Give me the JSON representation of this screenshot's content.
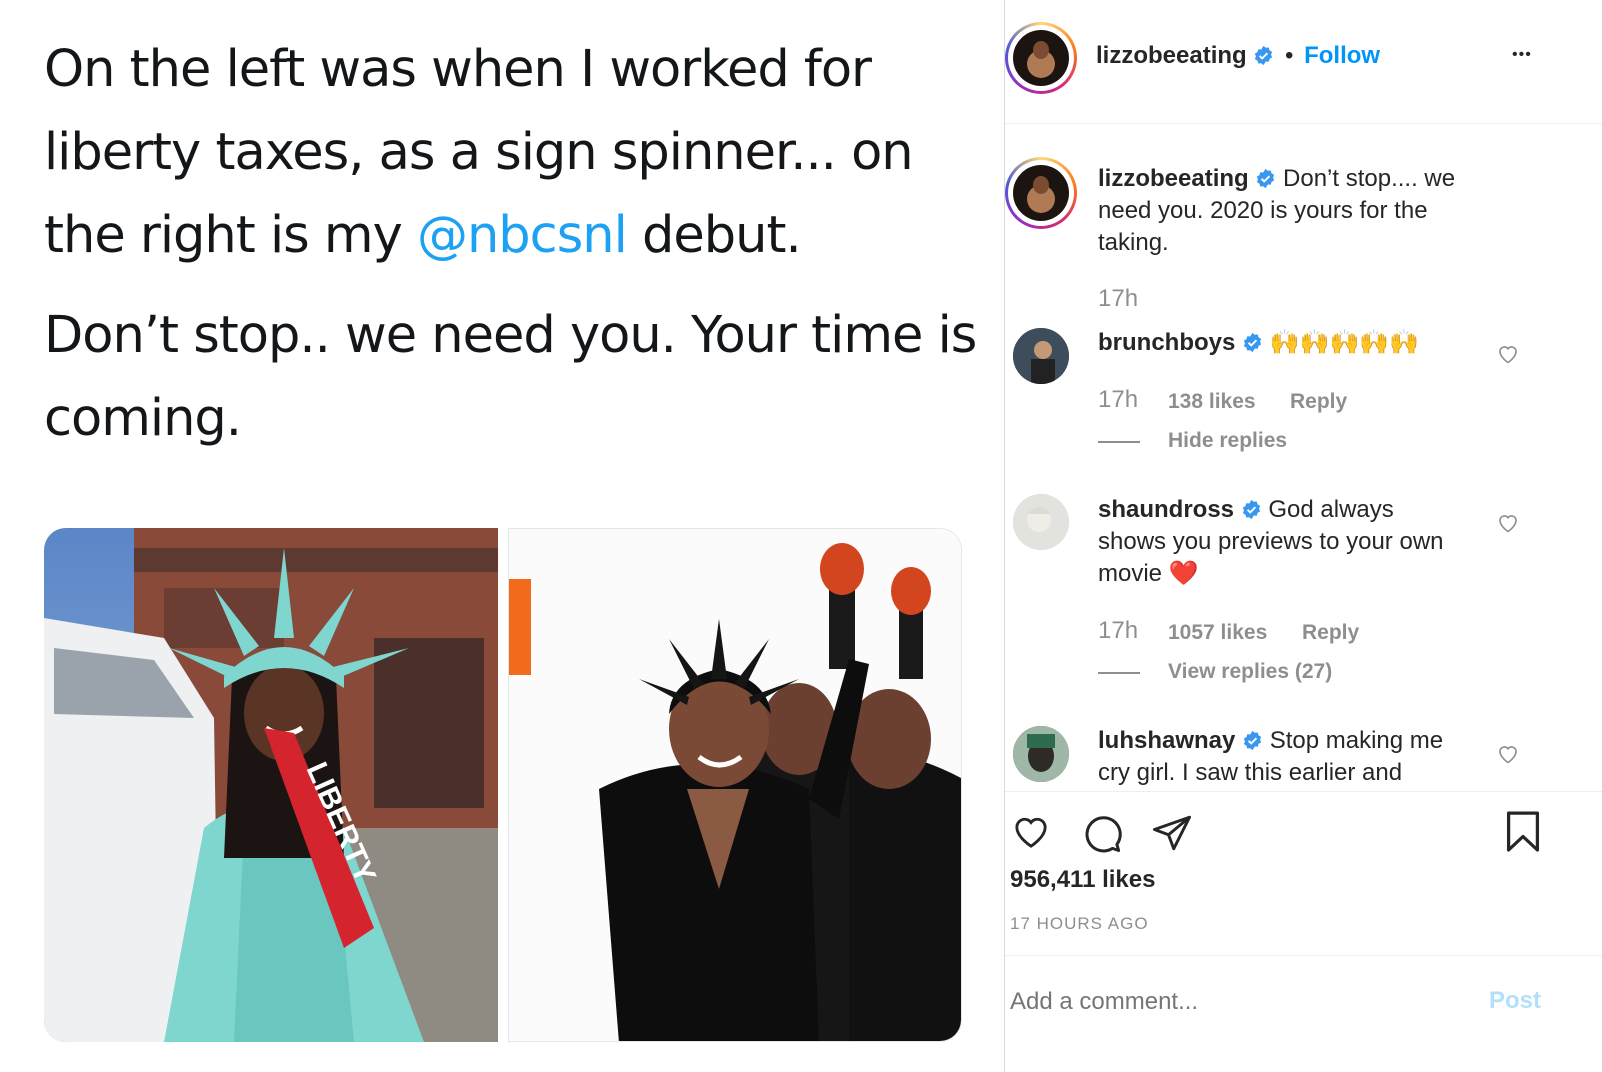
{
  "tweet": {
    "line1": "On the left was when I worked for liberty taxes, as a sign spinner... on the right is my ",
    "mention": "@nbcsnl",
    "line1_end": " debut.",
    "line2": "Don’t stop.. we need you. Your time is coming.",
    "sash_text": "LIBERTY"
  },
  "header": {
    "username": "lizzobeeating",
    "separator": "•",
    "follow_label": "Follow",
    "more_label": "•••"
  },
  "caption": {
    "username": "lizzobeeating",
    "text": " Don’t stop.... we need you. 2020 is yours for the taking.",
    "time": "17h"
  },
  "comments": [
    {
      "username": "brunchboys",
      "text": " 🙌🙌🙌🙌🙌",
      "time": "17h",
      "likes": "138 likes",
      "reply": "Reply",
      "thread": "Hide replies"
    },
    {
      "username": "shaundross",
      "text": " God always shows you previews to your own movie ❤️",
      "time": "17h",
      "likes": "1057 likes",
      "reply": "Reply",
      "thread": "View replies (27)"
    },
    {
      "username": "luhshawnay",
      "text": " Stop making me cry girl. I saw this earlier and"
    }
  ],
  "actions": {
    "likes": "956,411 likes",
    "timestamp": "17 HOURS AGO"
  },
  "composer": {
    "placeholder": "Add a comment...",
    "post_label": "Post"
  },
  "colors": {
    "link": "#0095f6",
    "verified": "#3897f0",
    "mention": "#1da1f2",
    "muted": "#8e8e8e",
    "post_disabled": "#b2dffc"
  },
  "icons": [
    "verified-badge-icon",
    "heart-icon",
    "comment-icon",
    "share-icon",
    "bookmark-icon",
    "more-icon"
  ]
}
